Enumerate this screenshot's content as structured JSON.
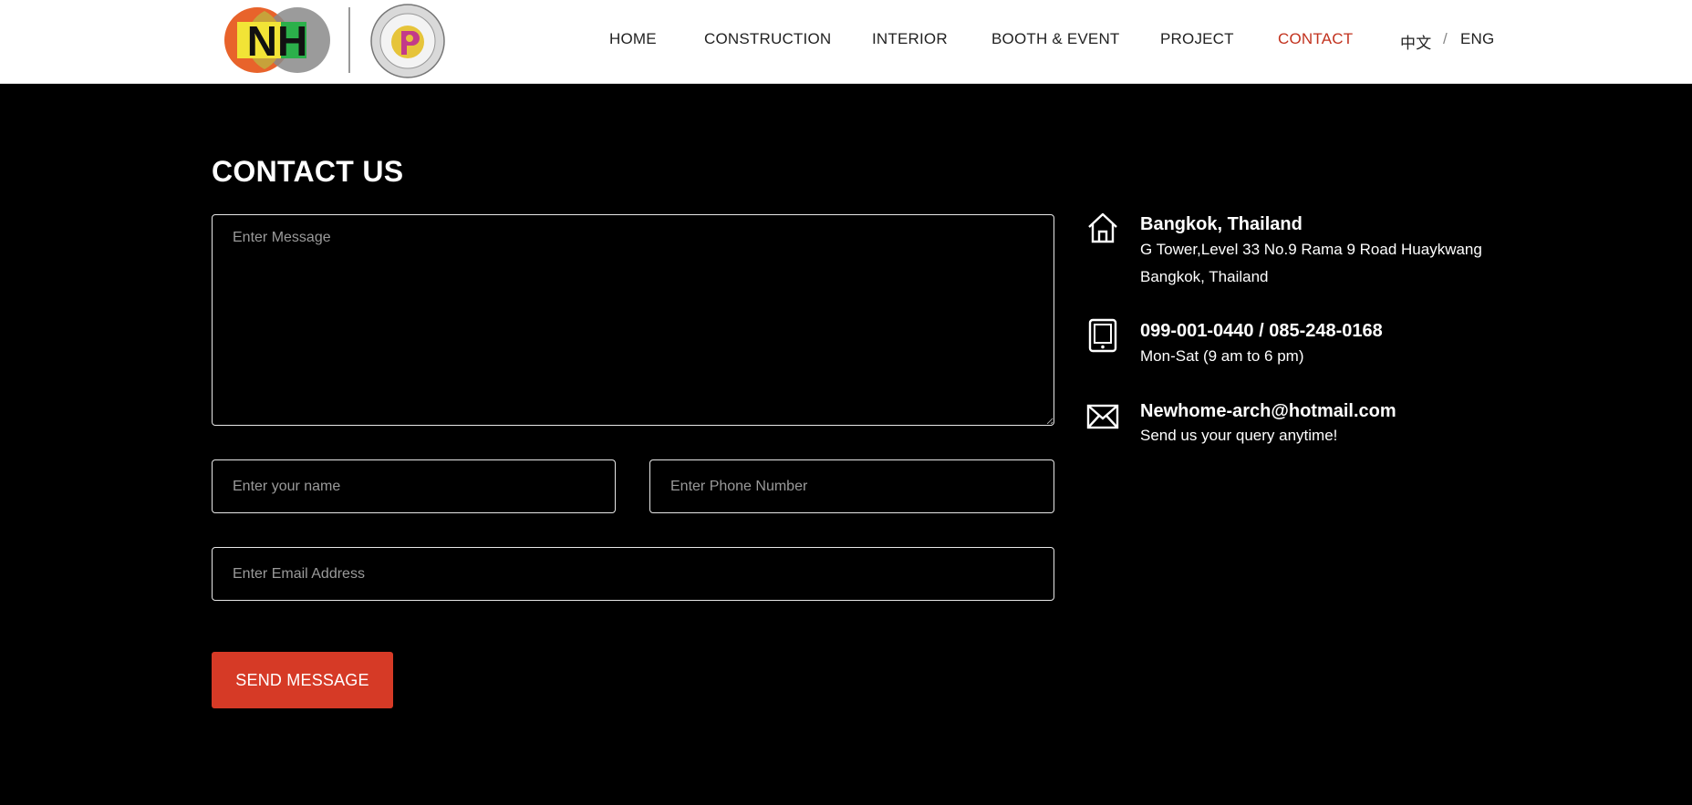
{
  "nav": {
    "items": [
      {
        "label": "HOME",
        "active": false
      },
      {
        "label": "CONSTRUCTION",
        "active": false
      },
      {
        "label": "INTERIOR",
        "active": false
      },
      {
        "label": "BOOTH & EVENT",
        "active": false
      },
      {
        "label": "PROJECT",
        "active": false
      },
      {
        "label": "CONTACT",
        "active": true
      }
    ],
    "lang": {
      "zh": "中文",
      "sep": "/",
      "en": "ENG"
    },
    "active_color": "#c2321e"
  },
  "logo": {
    "nh_text": "NH"
  },
  "contact": {
    "title": "CONTACT US",
    "form": {
      "message_placeholder": "Enter Message",
      "name_placeholder": "Enter your name",
      "phone_placeholder": "Enter Phone Number",
      "email_placeholder": "Enter Email Address",
      "submit_label": "SEND MESSAGE",
      "submit_color": "#d63a26"
    },
    "info": {
      "address": {
        "icon": "home-icon",
        "title": "Bangkok, Thailand",
        "line1": "G Tower,Level 33 No.9 Rama 9 Road Huaykwang",
        "line2": "Bangkok, Thailand"
      },
      "phone": {
        "icon": "tablet-icon",
        "title": "099-001-0440 / 085-248-0168",
        "line1": "Mon-Sat (9 am to 6 pm)"
      },
      "email": {
        "icon": "envelope-icon",
        "title": "Newhome-arch@hotmail.com",
        "line1": "Send us your query anytime!"
      }
    }
  }
}
